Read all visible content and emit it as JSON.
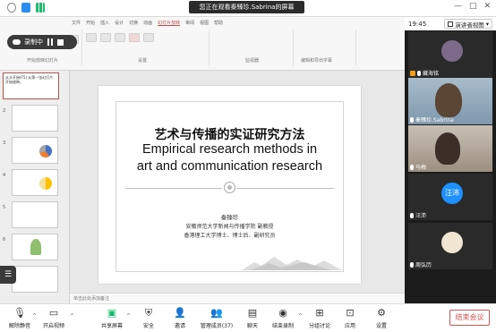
{
  "top_bar": {
    "share_banner": "您正在观看秦臻珍.Sabrina的屏幕",
    "window_controls": [
      "—",
      "□",
      "✕"
    ]
  },
  "recording": {
    "label": "录制中"
  },
  "ribbon": {
    "tabs": [
      "文件",
      "开始",
      "插入",
      "设计",
      "切换",
      "动画",
      "幻灯片放映",
      "审阅",
      "视图",
      "帮助"
    ],
    "groups": [
      "开始放映幻灯片",
      "设置",
      "监视器",
      "编辑和导出字幕"
    ]
  },
  "thumbnails": {
    "outline_text": "从头开始(F5)\n从第一张幻灯片开始放映。",
    "numbers": [
      "1",
      "2",
      "3",
      "4",
      "5",
      "6",
      "7"
    ]
  },
  "slide": {
    "title_cn": "艺术与传播的实证研究方法",
    "title_en_line1": "Empirical research methods in",
    "title_en_line2": "art and communication research",
    "author": "秦臻珍",
    "affiliation_1": "安徽师范大学新闻与传播学院  副教授",
    "affiliation_2": "香港理工大学博士、博士后、副研究员"
  },
  "notes": {
    "placeholder": "单击此处添加备注"
  },
  "right_panel": {
    "time": "19:45",
    "view_label": "演讲者视图",
    "participants": [
      {
        "name": "藏海铭",
        "type": "avatar",
        "color": "#7d6a8a"
      },
      {
        "name": "秦臻珍.Sabrina",
        "type": "video",
        "color": "#8fa5b4"
      },
      {
        "name": "马梅",
        "type": "video",
        "color": "#b3a89c"
      },
      {
        "name": "汪沛",
        "type": "avatar",
        "initials": "汪沛",
        "color": "#1e90ff"
      },
      {
        "name": "周弘历",
        "type": "avatar",
        "color": "#6a5d4d"
      }
    ]
  },
  "toolbar": {
    "items": [
      {
        "label": "解除静音",
        "icon": "mic-muted-icon"
      },
      {
        "label": "开启视频",
        "icon": "video-off-icon"
      },
      {
        "label": "共享屏幕",
        "icon": "screen-share-icon"
      },
      {
        "label": "安全",
        "icon": "shield-icon"
      },
      {
        "label": "邀请",
        "icon": "invite-icon"
      },
      {
        "label": "管理成员(37)",
        "icon": "members-icon"
      },
      {
        "label": "聊天",
        "icon": "chat-icon"
      },
      {
        "label": "结束录制",
        "icon": "stop-recording-icon"
      },
      {
        "label": "分组讨论",
        "icon": "breakout-icon"
      },
      {
        "label": "应用",
        "icon": "apps-icon"
      },
      {
        "label": "设置",
        "icon": "settings-icon"
      }
    ],
    "end_meeting": "结束会议"
  },
  "colors": {
    "accent_red": "#e05151",
    "dark_panel": "#1b1b1b"
  }
}
